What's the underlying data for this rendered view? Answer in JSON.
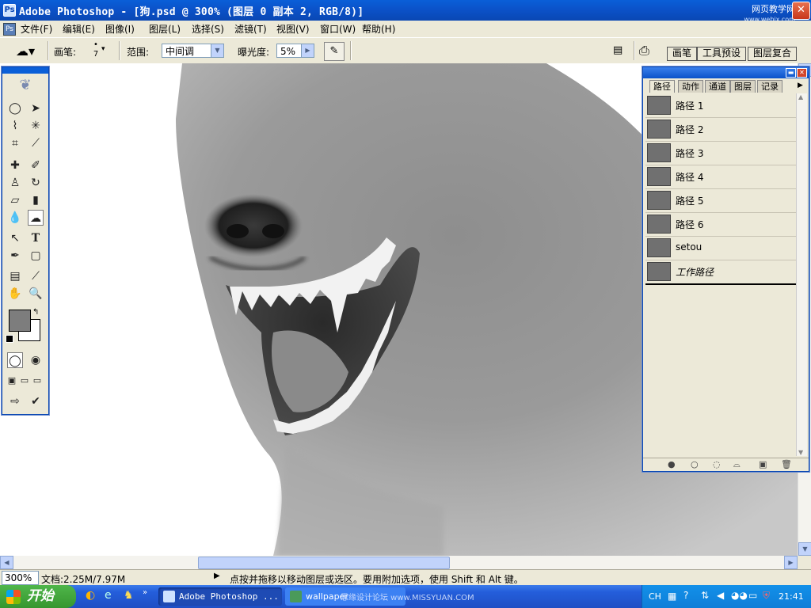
{
  "window": {
    "title": "Adobe Photoshop - [狗.psd @ 300% (图层 0 副本 2, RGB/8)]",
    "watermark_line1": "网页教学网",
    "watermark_line2": "www.webjx.com"
  },
  "menu": [
    "文件(F)",
    "编辑(E)",
    "图像(I)",
    "图层(L)",
    "选择(S)",
    "滤镜(T)",
    "视图(V)",
    "窗口(W)",
    "帮助(H)"
  ],
  "options": {
    "brush_label": "画笔:",
    "brush_size": "7",
    "range_label": "范围:",
    "range_value": "中间调",
    "exposure_label": "曝光度:",
    "exposure_value": "5%",
    "palette_tabs": [
      "画笔",
      "工具预设",
      "图层复合"
    ]
  },
  "panel": {
    "tabs": [
      "路径",
      "动作",
      "通道",
      "图层",
      "记录"
    ],
    "paths": [
      "路径 1",
      "路径 2",
      "路径 3",
      "路径 4",
      "路径 5",
      "路径 6",
      "setou",
      "工作路径"
    ],
    "active_path": "工作路径"
  },
  "status": {
    "zoom": "300%",
    "doc": "文档:2.25M/7.97M",
    "hint": "点按并拖移以移动图层或选区。要用附加选项，使用 Shift 和 Alt 键。"
  },
  "taskbar": {
    "start": "开始",
    "items": [
      "Adobe Photoshop ...",
      "wallpaper"
    ],
    "overlay": "思缘设计论坛 www.MISSYUAN.COM",
    "lang": "CH",
    "time": "21:41"
  },
  "tool_icons": [
    "ellipse-marquee-icon",
    "move-icon",
    "lasso-icon",
    "magic-wand-icon",
    "crop-icon",
    "slice-icon",
    "healing-brush-icon",
    "brush-icon",
    "stamp-icon",
    "history-brush-icon",
    "eraser-icon",
    "gradient-icon",
    "blur-icon",
    "sponge-icon",
    "path-select-icon",
    "text-icon",
    "pen-icon",
    "shape-icon",
    "notes-icon",
    "eyedropper-icon",
    "hand-icon",
    "zoom-icon"
  ]
}
